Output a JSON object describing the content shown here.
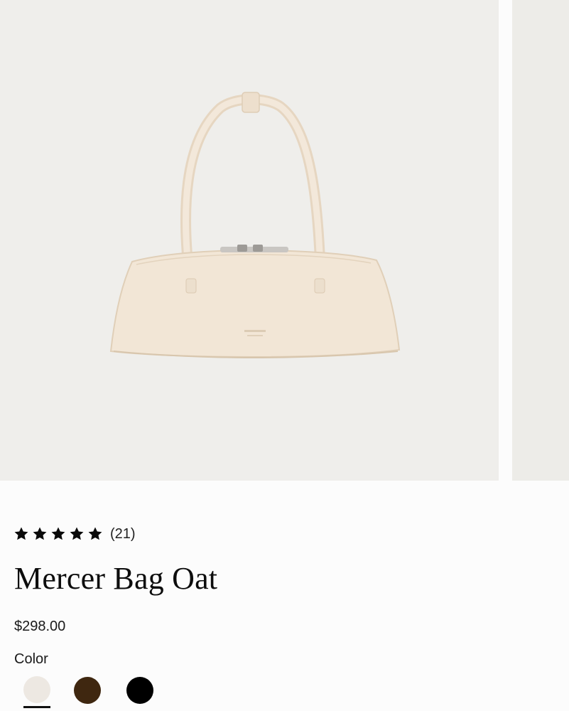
{
  "product": {
    "name": "Mercer Bag Oat",
    "price": "$298.00",
    "rating": {
      "stars": 5,
      "max_stars": 5,
      "review_count": "(21)"
    },
    "color_label": "Color",
    "colors": [
      {
        "name": "Oat",
        "hex": "#ede8e2",
        "selected": true
      },
      {
        "name": "Brown",
        "hex": "#3f2710",
        "selected": false
      },
      {
        "name": "Black",
        "hex": "#000000",
        "selected": false
      }
    ]
  },
  "gallery": {
    "background": "#efeeeb",
    "bag_color": "#f2e6d6"
  },
  "icons": {
    "rating_star": "star-icon"
  }
}
